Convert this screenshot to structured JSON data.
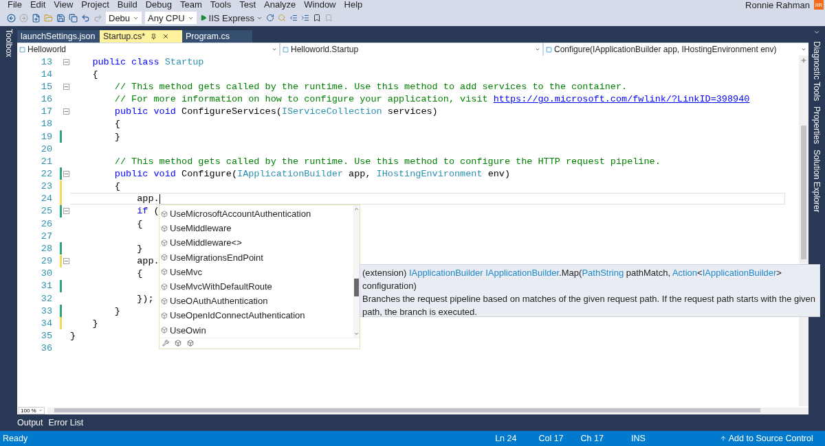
{
  "menu": [
    "File",
    "Edit",
    "View",
    "Project",
    "Build",
    "Debug",
    "Team",
    "Tools",
    "Test",
    "Analyze",
    "Window",
    "Help"
  ],
  "toolbar": {
    "configuration": "Debu",
    "platform": "Any CPU",
    "run_target": "IIS Express"
  },
  "account": {
    "name": "Ronnie Rahman",
    "initials": "RR"
  },
  "left_panels": [
    "Toolbox"
  ],
  "tabs": [
    {
      "label": "launchSettings.json",
      "selected": false
    },
    {
      "label": "Startup.cs*",
      "selected": true
    },
    {
      "label": "Program.cs",
      "selected": false
    }
  ],
  "navigation": [
    "Helloworld",
    "Helloworld.Startup",
    "Configure(IApplicationBuilder app, IHostingEnvironment env)"
  ],
  "code_lines": [
    {
      "number": "13",
      "foldable": true,
      "current": false,
      "tokens": [
        {
          "kind": "keyword",
          "text": "    public class "
        },
        {
          "kind": "type",
          "text": "Startup"
        }
      ]
    },
    {
      "number": "14",
      "foldable": false,
      "current": false,
      "tokens": [
        {
          "kind": "plain",
          "text": "    {"
        }
      ]
    },
    {
      "number": "15",
      "foldable": true,
      "current": false,
      "tokens": [
        {
          "kind": "comment",
          "text": "        // This method gets called by the runtime. Use this method to add services to the container."
        }
      ]
    },
    {
      "number": "16",
      "foldable": false,
      "current": false,
      "tokens": [
        {
          "kind": "comment",
          "text": "        // For more information on how to configure your application, visit "
        },
        {
          "kind": "link",
          "text": "https://go.microsoft.com/fwlink/?LinkID=398940"
        }
      ]
    },
    {
      "number": "17",
      "foldable": true,
      "current": false,
      "tokens": [
        {
          "kind": "keyword",
          "text": "        public void "
        },
        {
          "kind": "plain",
          "text": "ConfigureServices("
        },
        {
          "kind": "type",
          "text": "IServiceCollection"
        },
        {
          "kind": "plain",
          "text": " services)"
        }
      ]
    },
    {
      "number": "18",
      "foldable": false,
      "current": false,
      "tokens": [
        {
          "kind": "plain",
          "text": "        {"
        }
      ]
    },
    {
      "number": "19",
      "color": "#2aa876",
      "foldable": false,
      "current": false,
      "tokens": [
        {
          "kind": "plain",
          "text": "        }"
        }
      ]
    },
    {
      "number": "20",
      "foldable": false,
      "current": false
    },
    {
      "number": "21",
      "foldable": false,
      "current": false,
      "tokens": [
        {
          "kind": "comment",
          "text": "        // This method gets called by the runtime. Use this method to configure the HTTP request pipeline."
        }
      ]
    },
    {
      "number": "22",
      "color": "#2aa876",
      "foldable": true,
      "current": false,
      "tokens": [
        {
          "kind": "keyword",
          "text": "        public void "
        },
        {
          "kind": "plain",
          "text": "Configure("
        },
        {
          "kind": "type",
          "text": "IApplicationBuilder"
        },
        {
          "kind": "plain",
          "text": " app, "
        },
        {
          "kind": "type",
          "text": "IHostingEnvironment"
        },
        {
          "kind": "plain",
          "text": " env)"
        }
      ]
    },
    {
      "number": "23",
      "color": "#eedb5a",
      "foldable": false,
      "current": false,
      "tokens": [
        {
          "kind": "plain",
          "text": "        {"
        }
      ]
    },
    {
      "number": "24",
      "color": "#eedb5a",
      "foldable": false,
      "current": true,
      "tokens": [
        {
          "kind": "plain",
          "text": "            app."
        }
      ]
    },
    {
      "number": "25",
      "color": "#2aa876",
      "foldable": true,
      "current": false,
      "tokens": [
        {
          "kind": "keyword",
          "text": "            if"
        },
        {
          "kind": "plain",
          "text": " ("
        }
      ]
    },
    {
      "number": "26",
      "foldable": false,
      "current": false,
      "tokens": [
        {
          "kind": "plain",
          "text": "            {"
        }
      ]
    },
    {
      "number": "27",
      "foldable": false,
      "current": false
    },
    {
      "number": "28",
      "color": "#2aa876",
      "foldable": false,
      "current": false,
      "tokens": [
        {
          "kind": "plain",
          "text": "            }"
        }
      ]
    },
    {
      "number": "29",
      "color": "#eedb5a",
      "foldable": true,
      "current": false,
      "tokens": [
        {
          "kind": "plain",
          "text": "            app."
        }
      ]
    },
    {
      "number": "30",
      "foldable": false,
      "current": false,
      "tokens": [
        {
          "kind": "plain",
          "text": "            {"
        }
      ]
    },
    {
      "number": "31",
      "color": "#2aa876",
      "foldable": false,
      "current": false
    },
    {
      "number": "32",
      "foldable": false,
      "current": false,
      "tokens": [
        {
          "kind": "plain",
          "text": "            });"
        }
      ]
    },
    {
      "number": "33",
      "color": "#2aa876",
      "foldable": false,
      "current": false,
      "tokens": [
        {
          "kind": "plain",
          "text": "        }"
        }
      ]
    },
    {
      "number": "34",
      "color": "#eedb5a",
      "foldable": false,
      "current": false,
      "tokens": [
        {
          "kind": "plain",
          "text": "    }"
        }
      ]
    },
    {
      "number": "35",
      "foldable": false,
      "current": false,
      "tokens": [
        {
          "kind": "plain",
          "text": "}"
        }
      ]
    },
    {
      "number": "36",
      "foldable": false,
      "current": false
    }
  ],
  "completion": {
    "items": [
      "UseMicrosoftAccountAuthentication",
      "UseMiddleware",
      "UseMiddleware<>",
      "UseMigrationsEndPoint",
      "UseMvc",
      "UseMvcWithDefaultRoute",
      "UseOAuthAuthentication",
      "UseOpenIdConnectAuthentication",
      "UseOwin"
    ]
  },
  "tooltip": {
    "signature": [
      {
        "kind": "plain",
        "text": "(extension) "
      },
      {
        "kind": "type",
        "text": "IApplicationBuilder IApplicationBuilder"
      },
      {
        "kind": "plain",
        "text": ".Map("
      },
      {
        "kind": "type",
        "text": "PathString"
      },
      {
        "kind": "plain",
        "text": " pathMatch, "
      },
      {
        "kind": "type",
        "text": "Action"
      },
      {
        "kind": "plain",
        "text": "<"
      },
      {
        "kind": "type",
        "text": "IApplicationBuilder"
      },
      {
        "kind": "plain",
        "text": "> configuration)"
      }
    ],
    "description": "Branches the request pipeline based on matches of the given request path. If the request path starts with the given path, the branch is executed."
  },
  "zoom": "100 %",
  "bottom_tabs": [
    "Output",
    "Error List"
  ],
  "right_panels": [
    "Diagnostic Tools",
    "Properties",
    "Solution Explorer"
  ],
  "status": {
    "message": "Ready",
    "line": "Ln 24",
    "column": "Col 17",
    "char": "Ch 17",
    "mode": "INS",
    "source_control": "Add to Source Control"
  }
}
